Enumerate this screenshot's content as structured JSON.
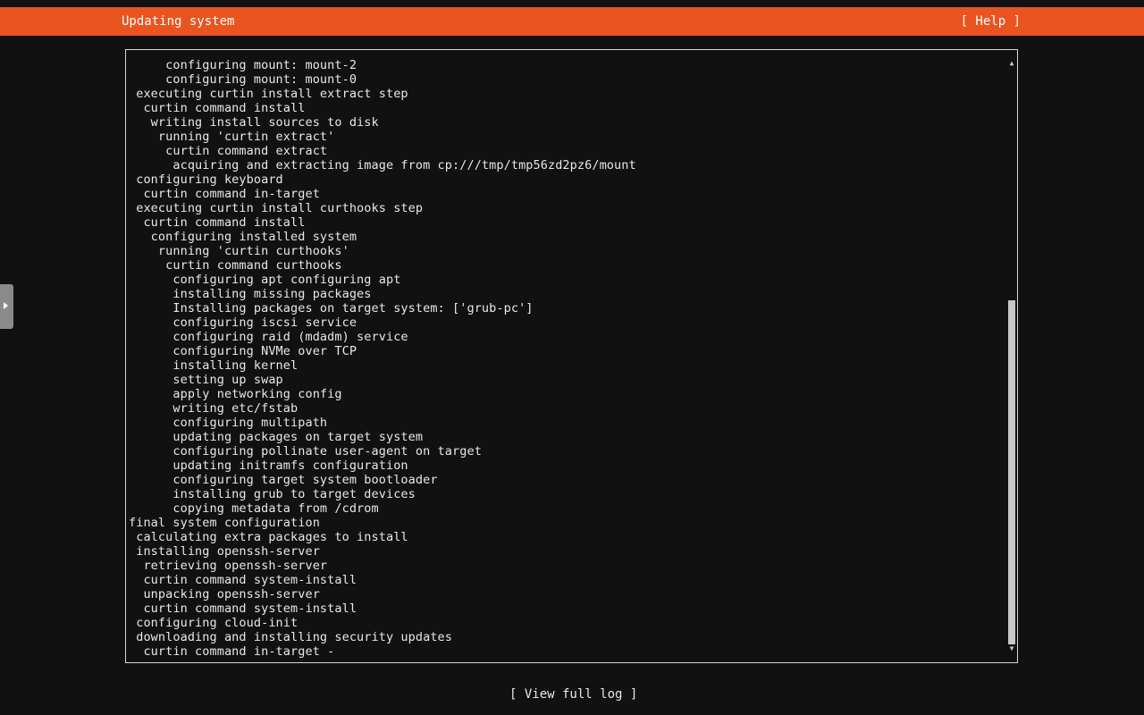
{
  "header": {
    "title": "Updating system",
    "help_label": "[ Help ]"
  },
  "log": {
    "lines": [
      "     configuring mount: mount-2",
      "     configuring mount: mount-0",
      " executing curtin install extract step",
      "  curtin command install",
      "   writing install sources to disk",
      "    running 'curtin extract'",
      "     curtin command extract",
      "      acquiring and extracting image from cp:///tmp/tmp56zd2pz6/mount",
      " configuring keyboard",
      "  curtin command in-target",
      " executing curtin install curthooks step",
      "  curtin command install",
      "   configuring installed system",
      "    running 'curtin curthooks'",
      "     curtin command curthooks",
      "      configuring apt configuring apt",
      "      installing missing packages",
      "      Installing packages on target system: ['grub-pc']",
      "      configuring iscsi service",
      "      configuring raid (mdadm) service",
      "      configuring NVMe over TCP",
      "      installing kernel",
      "      setting up swap",
      "      apply networking config",
      "      writing etc/fstab",
      "      configuring multipath",
      "      updating packages on target system",
      "      configuring pollinate user-agent on target",
      "      updating initramfs configuration",
      "      configuring target system bootloader",
      "      installing grub to target devices",
      "      copying metadata from /cdrom",
      "final system configuration",
      " calculating extra packages to install",
      " installing openssh-server",
      "  retrieving openssh-server",
      "  curtin command system-install",
      "  unpacking openssh-server",
      "  curtin command system-install",
      " configuring cloud-init",
      " downloading and installing security updates",
      "  curtin command in-target -"
    ]
  },
  "footer": {
    "view_log_label": "[ View full log ]"
  },
  "icons": {
    "scroll_up": "scroll-up-arrow",
    "scroll_down": "scroll-down-arrow",
    "side_tab": "expand-arrow"
  },
  "colors": {
    "accent": "#e95420",
    "background": "#111111",
    "text": "#e8e8e8"
  }
}
